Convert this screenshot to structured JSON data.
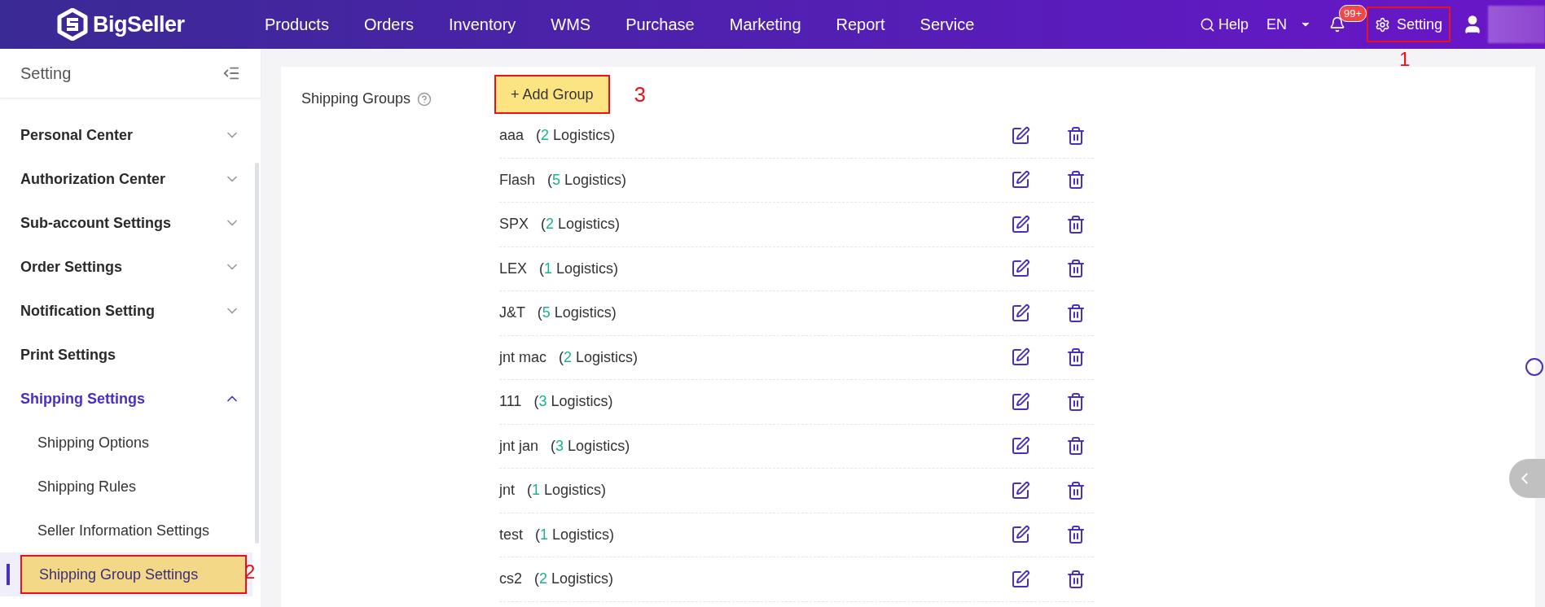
{
  "topbar": {
    "logo": "BigSeller",
    "nav": [
      {
        "label": "Products"
      },
      {
        "label": "Orders"
      },
      {
        "label": "Inventory"
      },
      {
        "label": "WMS"
      },
      {
        "label": "Purchase"
      },
      {
        "label": "Marketing"
      },
      {
        "label": "Report"
      },
      {
        "label": "Service"
      }
    ],
    "help": "Help",
    "language": "EN",
    "notifications": "99+",
    "setting": {
      "label": "Setting",
      "annotation": "1"
    }
  },
  "sidebar": {
    "title": "Setting",
    "items": [
      {
        "label": "Personal Center",
        "expandable": true,
        "expanded": false,
        "selected": false
      },
      {
        "label": "Authorization Center",
        "expandable": true,
        "expanded": false,
        "selected": false
      },
      {
        "label": "Sub-account Settings",
        "expandable": true,
        "expanded": false,
        "selected": false
      },
      {
        "label": "Order Settings",
        "expandable": true,
        "expanded": false,
        "selected": false
      },
      {
        "label": "Notification Setting",
        "expandable": true,
        "expanded": false,
        "selected": false
      },
      {
        "label": "Print Settings",
        "expandable": false,
        "selected": false
      },
      {
        "label": "Shipping Settings",
        "expandable": true,
        "expanded": true,
        "selected": true,
        "children": [
          {
            "label": "Shipping Options",
            "selected": false
          },
          {
            "label": "Shipping Rules",
            "selected": false
          },
          {
            "label": "Seller Information Settings",
            "selected": false
          },
          {
            "label": "Shipping Group Settings",
            "selected": true,
            "annotation": "2"
          }
        ]
      }
    ]
  },
  "content": {
    "label": "Shipping Groups",
    "add_button": {
      "label": "+ Add Group",
      "annotation": "3"
    },
    "groups": [
      {
        "name": "aaa",
        "open": "(",
        "count": "2",
        "rest": "Logistics)"
      },
      {
        "name": "Flash",
        "open": "(",
        "count": "5",
        "rest": "Logistics)"
      },
      {
        "name": "SPX",
        "open": "(",
        "count": "2",
        "rest": "Logistics)"
      },
      {
        "name": "LEX",
        "open": "(",
        "count": "1",
        "rest": "Logistics)"
      },
      {
        "name": "J&T",
        "open": "(",
        "count": "5",
        "rest": "Logistics)"
      },
      {
        "name": "jnt mac",
        "open": "(",
        "count": "2",
        "rest": "Logistics)"
      },
      {
        "name": "111",
        "open": "(",
        "count": "3",
        "rest": "Logistics)"
      },
      {
        "name": "jnt jan",
        "open": "(",
        "count": "3",
        "rest": "Logistics)"
      },
      {
        "name": "jnt",
        "open": "(",
        "count": "1",
        "rest": "Logistics)"
      },
      {
        "name": "test",
        "open": "(",
        "count": "1",
        "rest": "Logistics)"
      },
      {
        "name": "cs2",
        "open": "(",
        "count": "2",
        "rest": "Logistics)"
      }
    ]
  }
}
